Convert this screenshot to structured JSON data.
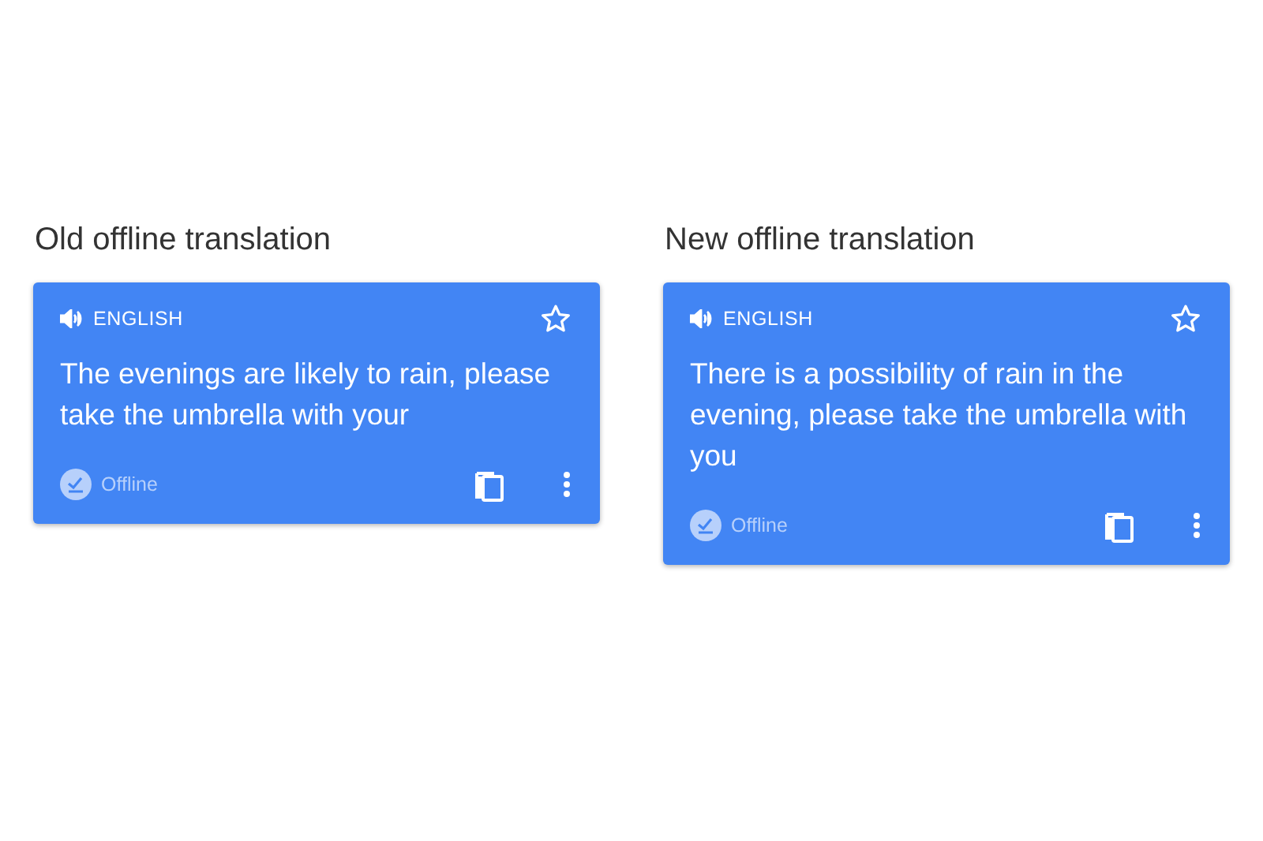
{
  "panels": [
    {
      "heading": "Old offline translation",
      "card": {
        "language": "ENGLISH",
        "text": "The evenings are likely to rain, please take the umbrella with your",
        "status": "Offline"
      }
    },
    {
      "heading": "New offline translation",
      "card": {
        "language": "ENGLISH",
        "text": "There is a possibility of rain in the evening, please take the umbrella with you",
        "status": "Offline"
      }
    }
  ]
}
